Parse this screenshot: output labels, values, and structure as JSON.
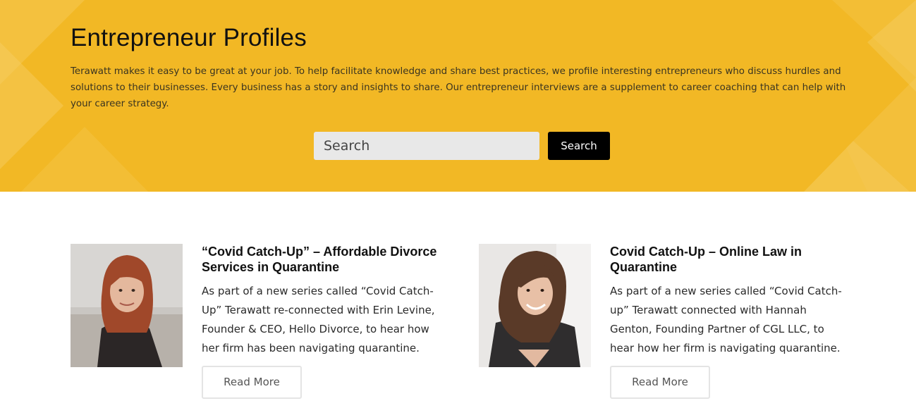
{
  "hero": {
    "title": "Entrepreneur Profiles",
    "description": "Terawatt makes it easy to be great at your job. To help facilitate knowledge and share best practices, we profile interesting entrepreneurs who discuss hurdles and solutions to their businesses. Every business has a story and insights to share. Our entrepreneur interviews are a supplement to career coaching that can help with your career strategy.",
    "background_color": "#f2b825"
  },
  "search": {
    "placeholder": "Search",
    "value": "",
    "button_label": "Search"
  },
  "profiles": [
    {
      "title": "“Covid Catch-Up” – Affordable Divorce Services in Quarantine",
      "excerpt": "As part of a new series called “Covid Catch-Up” Terawatt re-connected with Erin Levine, Founder & CEO, Hello Divorce, to hear how her firm has been navigating quarantine.",
      "read_more_label": "Read More",
      "photo": "portrait-woman-red-hair"
    },
    {
      "title": "Covid Catch-Up – Online Law in Quarantine",
      "excerpt": "As part of a new series called “Covid Catch-up” Terawatt connected with Hannah Genton, Founding Partner of CGL LLC, to hear how her firm is navigating quarantine.",
      "read_more_label": "Read More",
      "photo": "portrait-woman-brown-hair"
    }
  ]
}
